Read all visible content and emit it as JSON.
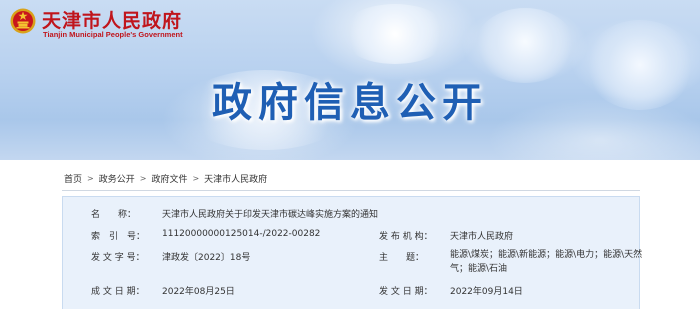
{
  "header": {
    "site_name": "天津市人民政府",
    "site_name_en": "Tianjin Municipal People's Government",
    "banner_title": "政府信息公开",
    "logo_icon": "national-emblem-icon",
    "colors": {
      "brand_red": "#c0151c",
      "title_blue": "#1f5fb4",
      "info_bg": "#e9f1fb"
    }
  },
  "breadcrumb": {
    "items": [
      "首页",
      "政务公开",
      "政府文件",
      "天津市人民政府"
    ],
    "separator": ">"
  },
  "info": {
    "name_label": "名　　称：",
    "name_value": "天津市人民政府关于印发天津市碳达峰实施方案的通知",
    "index_label": "索　引　号：",
    "index_value": "11120000000125014-/2022-00282",
    "issuer_label": "发 布 机 构：",
    "issuer_value": "天津市人民政府",
    "doc_no_label": "发 文 字 号：",
    "doc_no_value": "津政发〔2022〕18号",
    "subject_label": "主　　题：",
    "subject_value": "能源\\煤炭；能源\\新能源；能源\\电力；能源\\天然气；能源\\石油",
    "written_date_label": "成 文 日 期：",
    "written_date_value": "2022年08月25日",
    "publish_date_label": "发 文 日 期：",
    "publish_date_value": "2022年09月14日"
  }
}
